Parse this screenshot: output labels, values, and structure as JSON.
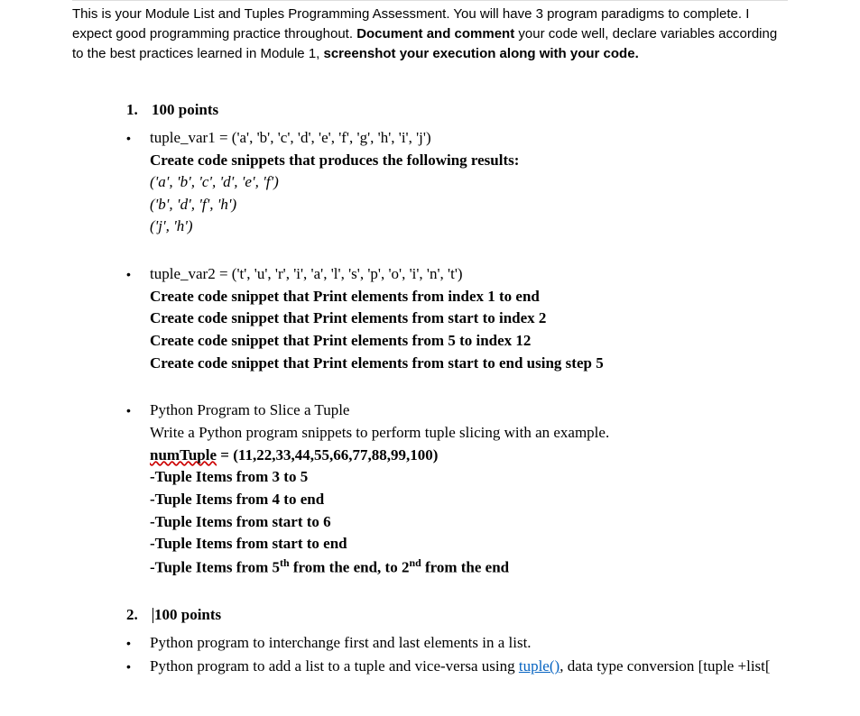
{
  "intro": {
    "p1a": "This is your Module List and Tuples Programming Assessment. You will have 3 program paradigms to complete. I expect good programming practice throughout. ",
    "p1b": "Document and comment",
    "p1c": " your code well, declare variables according to the best practices learned in Module 1, ",
    "p1d": "screenshot your execution along with your code.",
    "p1e": ""
  },
  "q1": {
    "num": "1.",
    "points": "100 points",
    "b1_line1": "tuple_var1 = ('a', 'b', 'c', 'd', 'e', 'f', 'g', 'h', 'i', 'j')",
    "b1_line2": "Create code snippets that produces the following results:",
    "b1_r1": "('a', 'b', 'c', 'd', 'e', 'f')",
    "b1_r2": "('b', 'd', 'f', 'h')",
    "b1_r3": "('j', 'h')",
    "b2_line1": "tuple_var2 = ('t', 'u', 'r', 'i', 'a', 'l', 's', 'p', 'o', 'i', 'n', 't')",
    "b2_line2": "Create code snippet that Print elements from index 1 to end",
    "b2_line3": "Create code snippet that Print elements from start to index 2",
    "b2_line4": "Create code snippet that Print elements from 5 to index 12",
    "b2_line5": "Create code snippet that Print elements from start to end using step 5",
    "b3_line1": "Python Program to Slice a Tuple",
    "b3_line2": "Write a Python program snippets to perform tuple slicing with an example.",
    "b3_line3a": "numTuple",
    "b3_line3b": " = (11,22,33,44,55,66,77,88,99,100)",
    "b3_r1": "-Tuple Items from 3 to 5",
    "b3_r2": "-Tuple Items from 4 to end",
    "b3_r3": "-Tuple Items from start to 6",
    "b3_r4": "-Tuple Items from start to end",
    "b3_r5a": "-Tuple Items from 5",
    "b3_r5b": "th",
    "b3_r5c": " from the end, to 2",
    "b3_r5d": "nd",
    "b3_r5e": " from the end"
  },
  "q2": {
    "num": "2.",
    "points": "100 points",
    "b1": "Python program to interchange first and last elements in a list.",
    "b2a": "Python program to add a list to a tuple and vice-versa using ",
    "b2b": "tuple()",
    "b2c": ", data type conversion [tuple +list["
  }
}
